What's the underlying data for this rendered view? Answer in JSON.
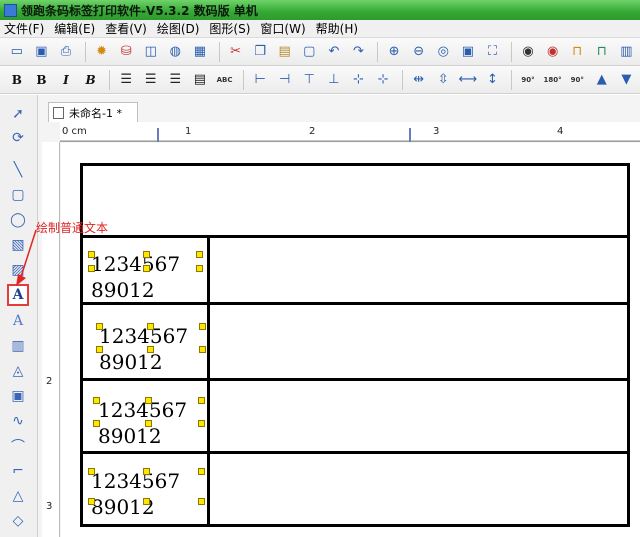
{
  "window": {
    "title": "领跑条码标签打印软件-V5.3.2 数码版 单机"
  },
  "menu": [
    "文件(F)",
    "编辑(E)",
    "查看(V)",
    "绘图(D)",
    "图形(S)",
    "窗口(W)",
    "帮助(H)"
  ],
  "toolbar2_text": {
    "bold": "B",
    "bold2": "B",
    "italic": "I",
    "bold_italic": "B",
    "abc": "ABC",
    "rotate90": "90°",
    "rotate180": "180°",
    "rotate270": "90°"
  },
  "tab": {
    "label": "未命名-1 *"
  },
  "ruler": {
    "zero": "0 cm",
    "one": "1",
    "two": "2",
    "three": "3",
    "four": "4",
    "v2": "2",
    "v3": "3"
  },
  "annotation": {
    "text": "绘制普通文本"
  },
  "cells": [
    {
      "line1": "1234567",
      "line2": "89012"
    },
    {
      "line1": "1234567",
      "line2": "89012"
    },
    {
      "line1": "1234567",
      "line2": "89012"
    },
    {
      "line1": "1234567",
      "line2": "89012"
    }
  ],
  "colors": {
    "accent": "#2a5db0",
    "title_bar": "#3db53d",
    "annotation": "#e02424",
    "handle": "#ffe600"
  }
}
